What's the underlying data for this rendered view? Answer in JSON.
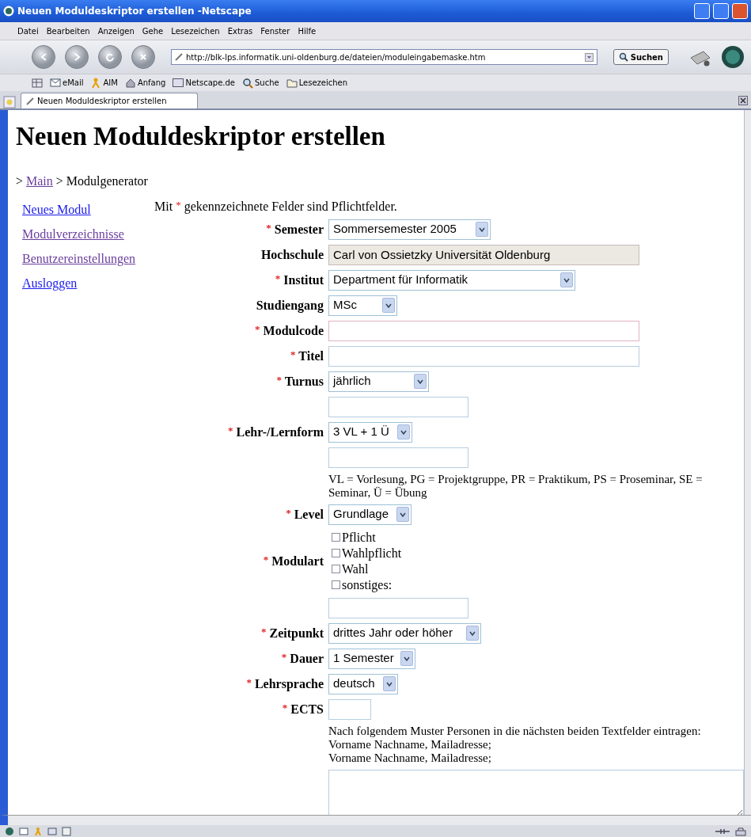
{
  "window": {
    "title": "Neuen Moduldeskriptor erstellen -Netscape"
  },
  "menu": [
    "Datei",
    "Bearbeiten",
    "Anzeigen",
    "Gehe",
    "Lesezeichen",
    "Extras",
    "Fenster",
    "Hilfe"
  ],
  "address": {
    "value": "http://blk-lps.informatik.uni-oldenburg.de/dateien/moduleingabemaske.htm"
  },
  "search_button": "Suchen",
  "bookmarks": [
    "eMail",
    "AIM",
    "Anfang",
    "Netscape.de",
    "Suche",
    "Lesezeichen"
  ],
  "tabs": [
    {
      "label": "Neuen Moduldeskriptor erstellen",
      "selected": true
    }
  ],
  "page": {
    "heading": "Neuen Moduldeskriptor erstellen",
    "breadcrumb": {
      "prefix": ">",
      "link": "Main",
      "rest": "> Modulgenerator"
    },
    "sidebar": [
      {
        "label": "Neues Modul",
        "visited": false
      },
      {
        "label": "Modulverzeichnisse",
        "visited": true
      },
      {
        "label": "Benutzereinstellungen",
        "visited": true
      },
      {
        "label": "Ausloggen",
        "visited": false
      }
    ],
    "intro": {
      "before": "Mit",
      "mark": "*",
      "after": "gekennzeichnete Felder sind Pflichtfelder."
    },
    "rows": [
      {
        "kind": "select",
        "mark": "*",
        "label": "Semester",
        "value": "Sommersemester 2005"
      },
      {
        "kind": "readonly",
        "label": "Hochschule",
        "value": "Carl von Ossietzky Universität Oldenburg"
      },
      {
        "kind": "select",
        "mark": "*",
        "label": "Institut",
        "value": "Department für Informatik"
      },
      {
        "kind": "select",
        "label": "Studiengang",
        "value": "MSc"
      },
      {
        "kind": "text",
        "mark": "*",
        "label": "Modulcode"
      },
      {
        "kind": "text",
        "mark": "*",
        "label": "Titel"
      },
      {
        "kind": "select",
        "mark": "*",
        "label": "Turnus",
        "value": "jährlich"
      },
      {
        "kind": "text"
      },
      {
        "kind": "select",
        "mark": "*",
        "label": "Lehr-/Lernform",
        "value": "3 VL + 1 Ü"
      },
      {
        "kind": "text"
      },
      {
        "kind": "note",
        "lines": [
          "VL = Vorlesung, PG = Projektgruppe, PR = Praktikum, PS = Proseminar, SE = Seminar, Ü = Übung"
        ]
      },
      {
        "kind": "select",
        "mark": "*",
        "label": "Level",
        "value": "Grundlage"
      },
      {
        "kind": "checkboxes",
        "mark": "*",
        "label": "Modulart",
        "options": [
          {
            "label": "Pflicht",
            "checked": false
          },
          {
            "label": "Wahlpflicht",
            "checked": false
          },
          {
            "label": "Wahl",
            "checked": false
          },
          {
            "label": "sonstiges:",
            "checked": false
          }
        ]
      },
      {
        "kind": "text"
      },
      {
        "kind": "select",
        "mark": "*",
        "label": "Zeitpunkt",
        "value": "drittes Jahr oder höher"
      },
      {
        "kind": "select",
        "mark": "*",
        "label": "Dauer",
        "value": "1 Semester"
      },
      {
        "kind": "select",
        "mark": "*",
        "label": "Lehrsprache",
        "value": "deutsch"
      },
      {
        "kind": "text",
        "mark": "*",
        "label": "ECTS"
      },
      {
        "kind": "note",
        "lines": [
          "Nach folgendem Muster Personen in die nächsten beiden Textfelder eintragen:",
          "Vorname Nachname, Mailadresse;",
          "Vorname Nachname, Mailadresse;"
        ]
      },
      {
        "kind": "textarea"
      }
    ]
  }
}
